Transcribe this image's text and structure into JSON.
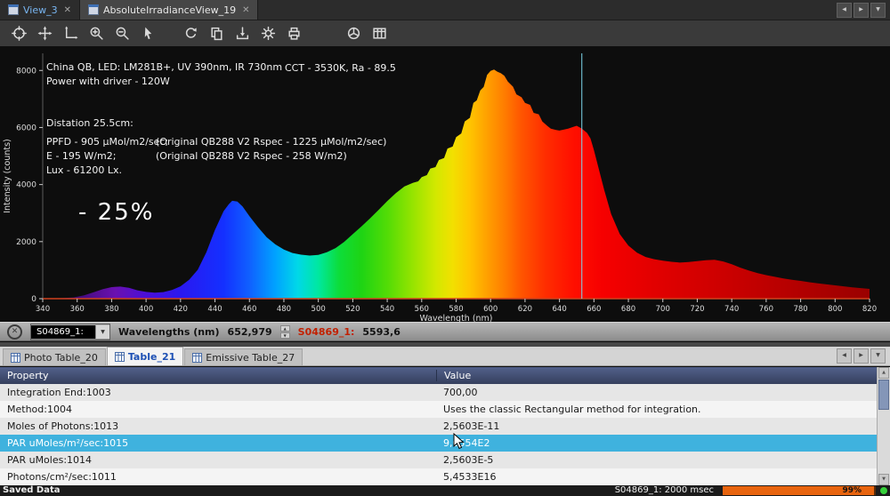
{
  "window": {
    "tabs": [
      {
        "label": "View_3"
      },
      {
        "label": "AbsoluteIrradianceView_19"
      }
    ]
  },
  "toolbar": {
    "icons": [
      "center-view-icon",
      "pan-icon",
      "move-axes-icon",
      "zoom-in-icon",
      "zoom-out-icon",
      "pointer-tool-icon",
      "refresh-icon",
      "copy-graph-icon",
      "save-graph-icon",
      "settings-gear-icon",
      "print-icon",
      "color-wheel-icon",
      "table-view-icon"
    ]
  },
  "chart": {
    "annotations": {
      "line1": "China QB, LED: LM281B+, UV 390nm, IR 730nm",
      "line2": "Power with driver - 120W",
      "cct": "CCT - 3530K, Ra - 89.5",
      "distance": "Distation 25.5cm:",
      "ppfd": "PPFD - 905 µMol/m2/sec;",
      "ppfd_ref": "(Original QB288 V2 Rspec - 1225 µMol/m2/sec)",
      "irradiance": "E - 195 W/m2;",
      "irradiance_ref": "(Original QB288 V2 Rspec - 258 W/m2)",
      "lux": "Lux - 61200 Lx.",
      "delta": "- 25%"
    }
  },
  "chart_data": {
    "type": "area",
    "title": "",
    "xlabel": "Wavelength (nm)",
    "ylabel": "Intensity (counts)",
    "xlim": [
      340,
      820
    ],
    "ylim": [
      0,
      8600
    ],
    "x_ticks": [
      340,
      360,
      380,
      400,
      420,
      440,
      460,
      480,
      500,
      520,
      540,
      560,
      580,
      600,
      620,
      640,
      660,
      680,
      700,
      720,
      740,
      760,
      780,
      800,
      820
    ],
    "y_ticks": [
      0,
      2000,
      4000,
      6000,
      8000
    ],
    "cursor_x": 652.979,
    "axis_color": "#d2421e",
    "cursor_color": "#7fd9ee",
    "series": [
      {
        "name": "S04869_1",
        "points": [
          [
            340,
            10
          ],
          [
            350,
            16
          ],
          [
            358,
            45
          ],
          [
            364,
            115
          ],
          [
            370,
            235
          ],
          [
            375,
            335
          ],
          [
            380,
            405
          ],
          [
            385,
            425
          ],
          [
            390,
            382
          ],
          [
            395,
            292
          ],
          [
            400,
            236
          ],
          [
            405,
            212
          ],
          [
            410,
            232
          ],
          [
            415,
            302
          ],
          [
            420,
            432
          ],
          [
            425,
            662
          ],
          [
            430,
            1012
          ],
          [
            435,
            1625
          ],
          [
            440,
            2405
          ],
          [
            445,
            3065
          ],
          [
            448,
            3305
          ],
          [
            450,
            3432
          ],
          [
            453,
            3405
          ],
          [
            456,
            3232
          ],
          [
            460,
            2892
          ],
          [
            465,
            2505
          ],
          [
            470,
            2152
          ],
          [
            475,
            1905
          ],
          [
            480,
            1722
          ],
          [
            485,
            1602
          ],
          [
            490,
            1542
          ],
          [
            495,
            1512
          ],
          [
            500,
            1536
          ],
          [
            505,
            1626
          ],
          [
            510,
            1772
          ],
          [
            515,
            1992
          ],
          [
            520,
            2262
          ],
          [
            525,
            2532
          ],
          [
            530,
            2812
          ],
          [
            535,
            3112
          ],
          [
            540,
            3422
          ],
          [
            545,
            3702
          ],
          [
            550,
            3932
          ],
          [
            555,
            4062
          ],
          [
            558,
            4112
          ],
          [
            560,
            4262
          ],
          [
            563,
            4332
          ],
          [
            565,
            4562
          ],
          [
            568,
            4612
          ],
          [
            570,
            4862
          ],
          [
            573,
            4932
          ],
          [
            575,
            5262
          ],
          [
            578,
            5332
          ],
          [
            580,
            5662
          ],
          [
            583,
            5792
          ],
          [
            585,
            6212
          ],
          [
            588,
            6342
          ],
          [
            590,
            6862
          ],
          [
            592,
            6952
          ],
          [
            594,
            7302
          ],
          [
            596,
            7422
          ],
          [
            598,
            7842
          ],
          [
            600,
            7982
          ],
          [
            602,
            8032
          ],
          [
            604,
            7952
          ],
          [
            606,
            7902
          ],
          [
            608,
            7812
          ],
          [
            610,
            7612
          ],
          [
            613,
            7432
          ],
          [
            615,
            7162
          ],
          [
            618,
            7062
          ],
          [
            620,
            6862
          ],
          [
            623,
            6792
          ],
          [
            625,
            6512
          ],
          [
            628,
            6462
          ],
          [
            630,
            6212
          ],
          [
            633,
            6052
          ],
          [
            635,
            5962
          ],
          [
            638,
            5912
          ],
          [
            640,
            5892
          ],
          [
            643,
            5932
          ],
          [
            645,
            5962
          ],
          [
            648,
            6022
          ],
          [
            650,
            6062
          ],
          [
            653,
            5962
          ],
          [
            656,
            5812
          ],
          [
            658,
            5612
          ],
          [
            660,
            5212
          ],
          [
            663,
            4512
          ],
          [
            666,
            3812
          ],
          [
            670,
            2962
          ],
          [
            675,
            2262
          ],
          [
            680,
            1862
          ],
          [
            685,
            1612
          ],
          [
            690,
            1462
          ],
          [
            695,
            1382
          ],
          [
            700,
            1332
          ],
          [
            705,
            1292
          ],
          [
            710,
            1266
          ],
          [
            715,
            1286
          ],
          [
            720,
            1316
          ],
          [
            725,
            1346
          ],
          [
            730,
            1366
          ],
          [
            735,
            1306
          ],
          [
            740,
            1206
          ],
          [
            745,
            1086
          ],
          [
            750,
            986
          ],
          [
            755,
            896
          ],
          [
            760,
            826
          ],
          [
            765,
            766
          ],
          [
            770,
            706
          ],
          [
            775,
            662
          ],
          [
            780,
            622
          ],
          [
            785,
            578
          ],
          [
            790,
            538
          ],
          [
            795,
            502
          ],
          [
            800,
            468
          ],
          [
            805,
            432
          ],
          [
            810,
            400
          ],
          [
            815,
            370
          ],
          [
            820,
            342
          ]
        ]
      }
    ],
    "spectral_gradient": [
      {
        "wl": 340,
        "color": "#2b0a50"
      },
      {
        "wl": 365,
        "color": "#4a0d86"
      },
      {
        "wl": 382,
        "color": "#6a10b0"
      },
      {
        "wl": 400,
        "color": "#4b0fd8"
      },
      {
        "wl": 420,
        "color": "#2a18f0"
      },
      {
        "wl": 445,
        "color": "#1430ff"
      },
      {
        "wl": 460,
        "color": "#1060ff"
      },
      {
        "wl": 475,
        "color": "#00a2ff"
      },
      {
        "wl": 488,
        "color": "#00d8e8"
      },
      {
        "wl": 500,
        "color": "#00e8a0"
      },
      {
        "wl": 512,
        "color": "#0ddd3a"
      },
      {
        "wl": 525,
        "color": "#1ed414"
      },
      {
        "wl": 540,
        "color": "#52dc06"
      },
      {
        "wl": 555,
        "color": "#97e400"
      },
      {
        "wl": 568,
        "color": "#d2e800"
      },
      {
        "wl": 578,
        "color": "#f2e000"
      },
      {
        "wl": 588,
        "color": "#ffc400"
      },
      {
        "wl": 598,
        "color": "#ffa000"
      },
      {
        "wl": 608,
        "color": "#ff7d00"
      },
      {
        "wl": 618,
        "color": "#ff5500"
      },
      {
        "wl": 632,
        "color": "#ff2d00"
      },
      {
        "wl": 648,
        "color": "#ff0f00"
      },
      {
        "wl": 665,
        "color": "#f60000"
      },
      {
        "wl": 695,
        "color": "#e20000"
      },
      {
        "wl": 730,
        "color": "#cf0000"
      },
      {
        "wl": 775,
        "color": "#b50000"
      },
      {
        "wl": 820,
        "color": "#9a0000"
      }
    ]
  },
  "status_strip": {
    "source_label": "S04869_1:",
    "wavelength_label": "Wavelengths (nm)",
    "wavelength_value": "652,979",
    "series_label": "S04869_1:",
    "series_value": "5593,6"
  },
  "table_panel": {
    "tabs": [
      {
        "label": "Photo Table_20"
      },
      {
        "label": "Table_21"
      },
      {
        "label": "Emissive Table_27"
      }
    ],
    "columns": [
      "Property",
      "Value"
    ],
    "rows": [
      {
        "property": "Integration End:1003",
        "value": "700,00"
      },
      {
        "property": "Method:1004",
        "value": "Uses the classic Rectangular method for integration."
      },
      {
        "property": "Moles of Photons:1013",
        "value": "2,5603E-11"
      },
      {
        "property": "PAR uMoles/m²/sec:1015",
        "value": "9,0554E2"
      },
      {
        "property": "PAR uMoles:1014",
        "value": "2,5603E-5"
      },
      {
        "property": "Photons/cm²/sec:1011",
        "value": "5,4533E16"
      }
    ],
    "selected_row_index": 3
  },
  "status_bar": {
    "left": "Saved Data",
    "acquisition": "S04869_1: 2000 msec",
    "progress": "99%"
  },
  "colors": {
    "selected_row": "#3fb2de",
    "progress_fill": "#e8640e"
  }
}
